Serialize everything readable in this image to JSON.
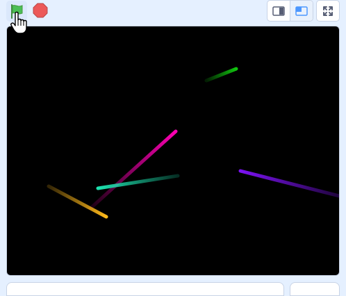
{
  "toolbar": {
    "green_flag": {
      "icon": "green-flag-icon",
      "color": "#4cbf56"
    },
    "stop": {
      "icon": "stop-sign-icon",
      "color": "#ec5959"
    },
    "small_stage": {
      "icon": "small-stage-icon"
    },
    "normal_stage": {
      "icon": "normal-stage-icon",
      "selected": true,
      "accent": "#4c97ff"
    },
    "fullscreen": {
      "icon": "fullscreen-icon"
    }
  },
  "stage": {
    "background": "#000000",
    "sprites": [
      {
        "name": "green-line",
        "color": "#11c40f"
      },
      {
        "name": "magenta-line",
        "color": "#ff00b4"
      },
      {
        "name": "teal-line",
        "color": "#1de3b0"
      },
      {
        "name": "orange-line",
        "color": "#ffb91a"
      },
      {
        "name": "purple-line",
        "color": "#7b12f2"
      }
    ]
  }
}
